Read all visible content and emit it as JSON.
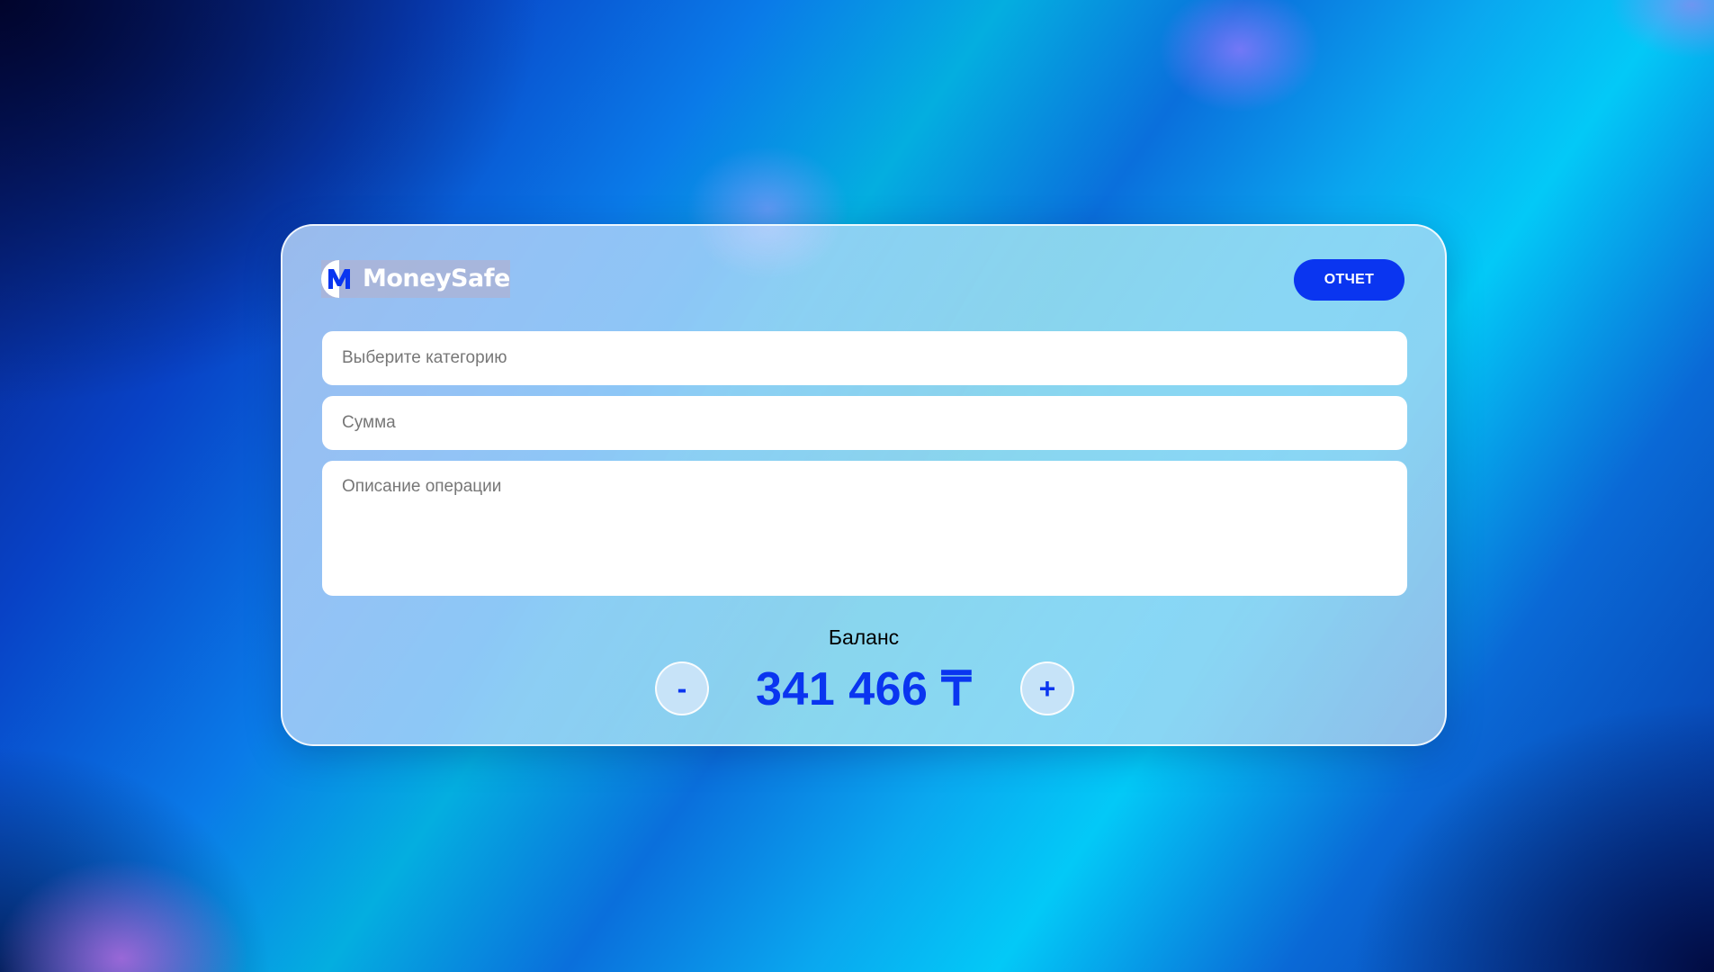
{
  "app": {
    "name": "MoneySafe",
    "logo_letter": "M"
  },
  "header": {
    "report_label": "ОТЧЕТ"
  },
  "form": {
    "category_placeholder": "Выберите категорию",
    "category_value": "",
    "amount_placeholder": "Сумма",
    "amount_value": "",
    "description_placeholder": "Описание операции",
    "description_value": ""
  },
  "balance": {
    "label": "Баланс",
    "value": "341 466 ₸",
    "minus_label": "-",
    "plus_label": "+"
  },
  "colors": {
    "accent": "#0a35f0",
    "card": "#a8d4f5"
  },
  "icons": {
    "logo": "moneysafe-logo-icon"
  }
}
